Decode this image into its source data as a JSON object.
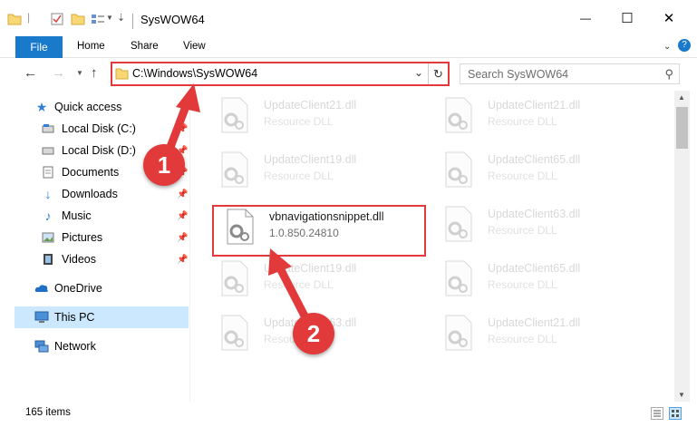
{
  "window": {
    "title": "SysWOW64",
    "minimize": "—",
    "maximize": "☐",
    "close": "✕"
  },
  "ribbon": {
    "tabs": [
      "File",
      "Home",
      "Share",
      "View"
    ]
  },
  "address": {
    "path": "C:\\Windows\\SysWOW64",
    "search_placeholder": "Search SysWOW64"
  },
  "sidebar": {
    "items": [
      {
        "label": "Quick access",
        "icon": "star-icon",
        "pinned": false
      },
      {
        "label": "Local Disk (C:)",
        "icon": "drive-icon",
        "pinned": true
      },
      {
        "label": "Local Disk (D:)",
        "icon": "drive-icon",
        "pinned": true
      },
      {
        "label": "Documents",
        "icon": "documents-icon",
        "pinned": true
      },
      {
        "label": "Downloads",
        "icon": "download-icon",
        "pinned": true
      },
      {
        "label": "Music",
        "icon": "music-icon",
        "pinned": true
      },
      {
        "label": "Pictures",
        "icon": "pictures-icon",
        "pinned": true
      },
      {
        "label": "Videos",
        "icon": "videos-icon",
        "pinned": true
      },
      {
        "label": "OneDrive",
        "icon": "cloud-icon",
        "pinned": false
      },
      {
        "label": "This PC",
        "icon": "computer-icon",
        "pinned": false,
        "selected": true
      },
      {
        "label": "Network",
        "icon": "network-icon",
        "pinned": false
      }
    ]
  },
  "files": [
    {
      "name": "UpdateClient21.dll",
      "desc": "Resource DLL"
    },
    {
      "name": "UpdateClient21.dll",
      "desc": "Resource DLL"
    },
    {
      "name": "UpdateClient19.dll",
      "desc": "Resource DLL"
    },
    {
      "name": "UpdateClient65.dll",
      "desc": "Resource DLL"
    },
    {
      "name": "vbnavigationsnippet.dll",
      "desc": "1.0.850.24810"
    },
    {
      "name": "UpdateClient63.dll",
      "desc": "Resource DLL"
    },
    {
      "name": "UpdateClient19.dll",
      "desc": "Resource DLL"
    },
    {
      "name": "UpdateClient65.dll",
      "desc": "Resource DLL"
    },
    {
      "name": "UpdateClient63.dll",
      "desc": "Resource DLL"
    },
    {
      "name": "UpdateClient21.dll",
      "desc": "Resource DLL"
    }
  ],
  "annotations": {
    "step1": "1",
    "step2": "2"
  },
  "status": {
    "item_count": "165 items"
  },
  "colors": {
    "accent": "#1979ca",
    "annotation": "#e23a3a",
    "selected_bg": "#cce8ff"
  }
}
